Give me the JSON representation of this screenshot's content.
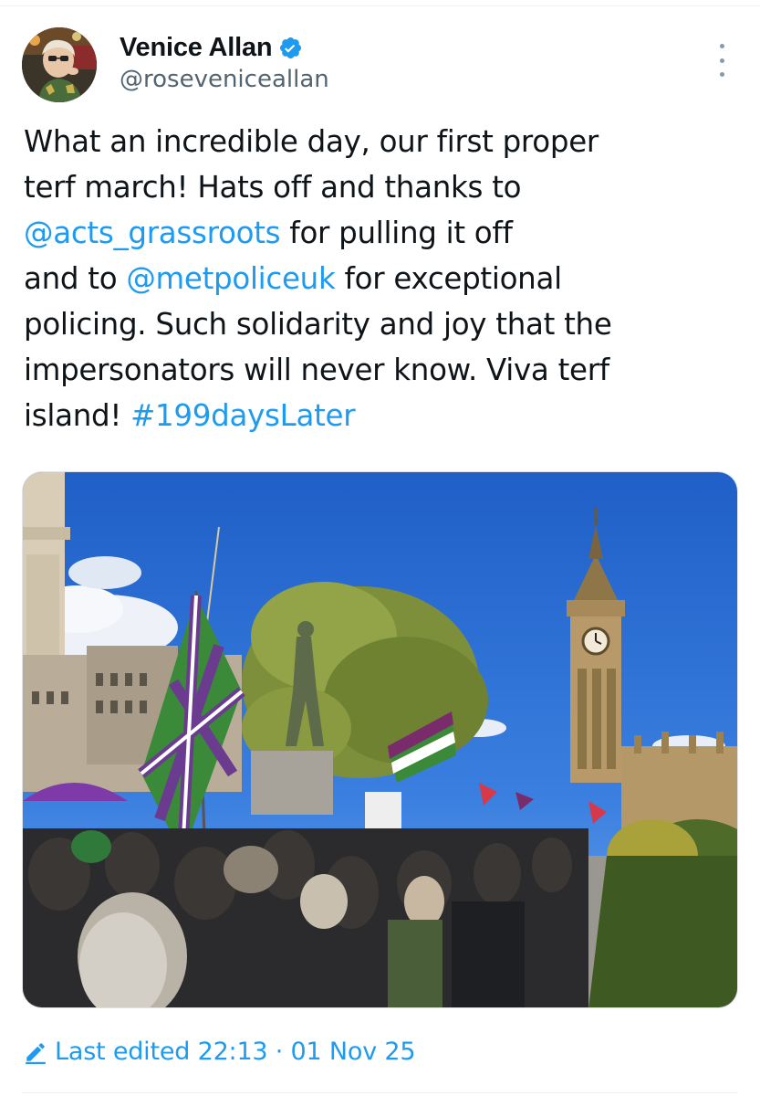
{
  "author": {
    "display_name": "Venice Allan",
    "handle": "@roseveniceallan",
    "verified": true,
    "avatar_icon": "profile-photo"
  },
  "tweet": {
    "lines": [
      [
        {
          "text": "What an incredible day, our first proper",
          "link": false
        }
      ],
      [
        {
          "text": "terf march! Hats off and thanks to",
          "link": false
        }
      ],
      [
        {
          "text": "@acts_grassroots",
          "link": true
        },
        {
          "text": " for pulling it off",
          "link": false
        }
      ],
      [
        {
          "text": "and to ",
          "link": false
        },
        {
          "text": "@metpoliceuk",
          "link": true
        },
        {
          "text": " for exceptional",
          "link": false
        }
      ],
      [
        {
          "text": "policing. Such solidarity and joy that the",
          "link": false
        }
      ],
      [
        {
          "text": "impersonators will never know. Viva terf",
          "link": false
        }
      ],
      [
        {
          "text": "island! ",
          "link": false
        },
        {
          "text": "#199daysLater",
          "link": true
        }
      ]
    ]
  },
  "media": {
    "kind": "photo",
    "subject": "march crowd near Big Ben"
  },
  "footer": {
    "edited_label": "Last edited 22:13 · 01 Nov 25",
    "edited_icon": "pencil-icon"
  },
  "colors": {
    "link": "#1d9bf0",
    "text": "#0f1419",
    "secondary": "#536471",
    "verified": "#1d9bf0"
  }
}
